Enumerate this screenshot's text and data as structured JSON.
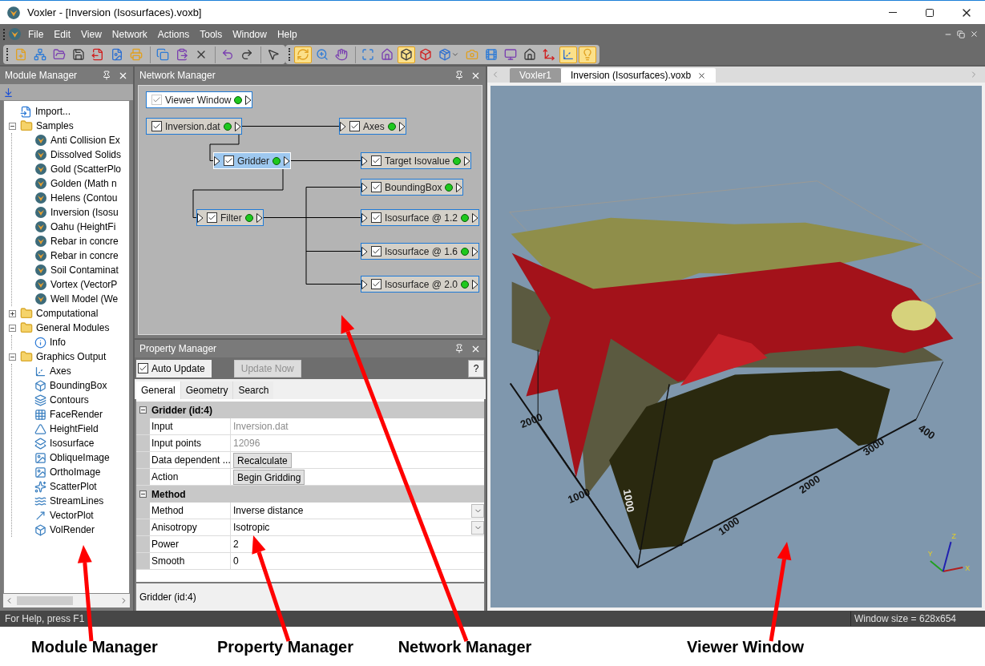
{
  "window": {
    "title": "Voxler - [Inversion (Isosurfaces).voxb]"
  },
  "menu": [
    "File",
    "Edit",
    "View",
    "Network",
    "Actions",
    "Tools",
    "Window",
    "Help"
  ],
  "toolbar": {
    "groups": [
      {
        "buttons": [
          {
            "pressed": false
          },
          {
            "pressed": false
          },
          {
            "pressed": false
          },
          {
            "pressed": false
          },
          {
            "pressed": false
          },
          {
            "pressed": false
          },
          {
            "pressed": false
          }
        ]
      },
      {
        "buttons": [
          {
            "pressed": false
          },
          {
            "pressed": false
          },
          {
            "pressed": false
          }
        ]
      },
      {
        "buttons": [
          {
            "pressed": false
          },
          {
            "pressed": false
          }
        ]
      },
      {
        "buttons": [
          {
            "pressed": false
          }
        ]
      },
      {
        "buttons": [
          {
            "pressed": true
          },
          {
            "pressed": false
          },
          {
            "pressed": false
          }
        ]
      },
      {
        "buttons": [
          {
            "pressed": false
          },
          {
            "pressed": false
          },
          {
            "pressed": true
          },
          {
            "pressed": false
          },
          {
            "pressed": false
          },
          {
            "pressed": false
          },
          {
            "pressed": false
          },
          {
            "pressed": false
          },
          {
            "pressed": false
          },
          {
            "pressed": false
          },
          {
            "pressed": true
          },
          {
            "pressed": true
          }
        ]
      }
    ]
  },
  "module_manager": {
    "title": "Module Manager",
    "tree": [
      {
        "label": "Import...",
        "kind": "import"
      },
      {
        "label": "Samples",
        "kind": "folder",
        "expanded": true,
        "children": [
          {
            "label": "Anti Collision Ex",
            "kind": "sample"
          },
          {
            "label": "Dissolved Solids",
            "kind": "sample"
          },
          {
            "label": "Gold (ScatterPlo",
            "kind": "sample"
          },
          {
            "label": "Golden (Math n",
            "kind": "sample"
          },
          {
            "label": "Helens (Contou",
            "kind": "sample"
          },
          {
            "label": "Inversion (Isosu",
            "kind": "sample"
          },
          {
            "label": "Oahu (HeightFi",
            "kind": "sample"
          },
          {
            "label": "Rebar in concre",
            "kind": "sample"
          },
          {
            "label": "Rebar in concre",
            "kind": "sample"
          },
          {
            "label": "Soil Contaminat",
            "kind": "sample"
          },
          {
            "label": "Vortex (VectorP",
            "kind": "sample"
          },
          {
            "label": "Well Model (We",
            "kind": "sample"
          }
        ]
      },
      {
        "label": "Computational",
        "kind": "folder",
        "expanded": false
      },
      {
        "label": "General Modules",
        "kind": "folder",
        "expanded": true,
        "children": [
          {
            "label": "Info",
            "kind": "info"
          }
        ]
      },
      {
        "label": "Graphics Output",
        "kind": "folder",
        "expanded": true,
        "children": [
          {
            "label": "Axes",
            "kind": "module"
          },
          {
            "label": "BoundingBox",
            "kind": "module"
          },
          {
            "label": "Contours",
            "kind": "module"
          },
          {
            "label": "FaceRender",
            "kind": "module"
          },
          {
            "label": "HeightField",
            "kind": "module"
          },
          {
            "label": "Isosurface",
            "kind": "module"
          },
          {
            "label": "ObliqueImage",
            "kind": "module"
          },
          {
            "label": "OrthoImage",
            "kind": "module"
          },
          {
            "label": "ScatterPlot",
            "kind": "module"
          },
          {
            "label": "StreamLines",
            "kind": "module"
          },
          {
            "label": "VectorPlot",
            "kind": "module"
          },
          {
            "label": "VolRender",
            "kind": "module"
          }
        ]
      }
    ]
  },
  "network_manager": {
    "title": "Network Manager",
    "nodes": [
      {
        "label": "Viewer Window",
        "checked": true,
        "disabled": true,
        "selected": false,
        "has_input": false
      },
      {
        "label": "Inversion.dat",
        "checked": true,
        "disabled": false,
        "selected": false,
        "has_input": false
      },
      {
        "label": "Axes",
        "checked": true,
        "disabled": false,
        "selected": false,
        "has_input": true
      },
      {
        "label": "Gridder",
        "checked": true,
        "disabled": false,
        "selected": true,
        "has_input": true
      },
      {
        "label": "Target Isovalue",
        "checked": true,
        "disabled": false,
        "selected": false,
        "has_input": true
      },
      {
        "label": "BoundingBox",
        "checked": true,
        "disabled": false,
        "selected": false,
        "has_input": true
      },
      {
        "label": "Filter",
        "checked": true,
        "disabled": false,
        "selected": false,
        "has_input": true
      },
      {
        "label": "Isosurface @ 1.2",
        "checked": true,
        "disabled": false,
        "selected": false,
        "has_input": true
      },
      {
        "label": "Isosurface @ 1.6",
        "checked": true,
        "disabled": false,
        "selected": false,
        "has_input": true
      },
      {
        "label": "Isosurface @ 2.0",
        "checked": true,
        "disabled": false,
        "selected": false,
        "has_input": true
      }
    ]
  },
  "property_manager": {
    "title": "Property Manager",
    "auto_update": {
      "label": "Auto Update",
      "checked": true
    },
    "update_button": {
      "label": "Update Now",
      "disabled": true
    },
    "help_button": "?",
    "tabs": [
      {
        "label": "General",
        "selected": true
      },
      {
        "label": "Geometry",
        "selected": false
      },
      {
        "label": "Search",
        "selected": false
      }
    ],
    "sections": [
      {
        "title": "Gridder (id:4)",
        "expanded": true,
        "rows": [
          {
            "name": "Input",
            "value": "Inversion.dat",
            "kind": "readonly"
          },
          {
            "name": "Input points",
            "value": "12096",
            "kind": "readonly"
          },
          {
            "name": "Data dependent ...",
            "value": "Recalculate",
            "kind": "button"
          },
          {
            "name": "Action",
            "value": "Begin Gridding",
            "kind": "button"
          }
        ]
      },
      {
        "title": "Method",
        "expanded": true,
        "rows": [
          {
            "name": "Method",
            "value": "Inverse distance",
            "kind": "dropdown"
          },
          {
            "name": "Anisotropy",
            "value": "Isotropic",
            "kind": "dropdown"
          },
          {
            "name": "Power",
            "value": "2",
            "kind": "text"
          },
          {
            "name": "Smooth",
            "value": "0",
            "kind": "text"
          }
        ]
      }
    ],
    "description": "Gridder (id:4)"
  },
  "viewer": {
    "tabs": [
      {
        "label": "Voxler1",
        "selected": false
      },
      {
        "label": "Inversion (Isosurfaces).voxb",
        "selected": true
      }
    ],
    "axis_labels": [
      "2000",
      "1000",
      "1000",
      "2000",
      "3000",
      "400",
      "1000"
    ],
    "triad_labels": [
      "X",
      "Y",
      "Z"
    ]
  },
  "status_bar": {
    "left": "For Help, press F1",
    "right": "Window size = 628x654"
  },
  "callouts": [
    "Module Manager",
    "Property Manager",
    "Network Manager",
    "Viewer Window"
  ]
}
